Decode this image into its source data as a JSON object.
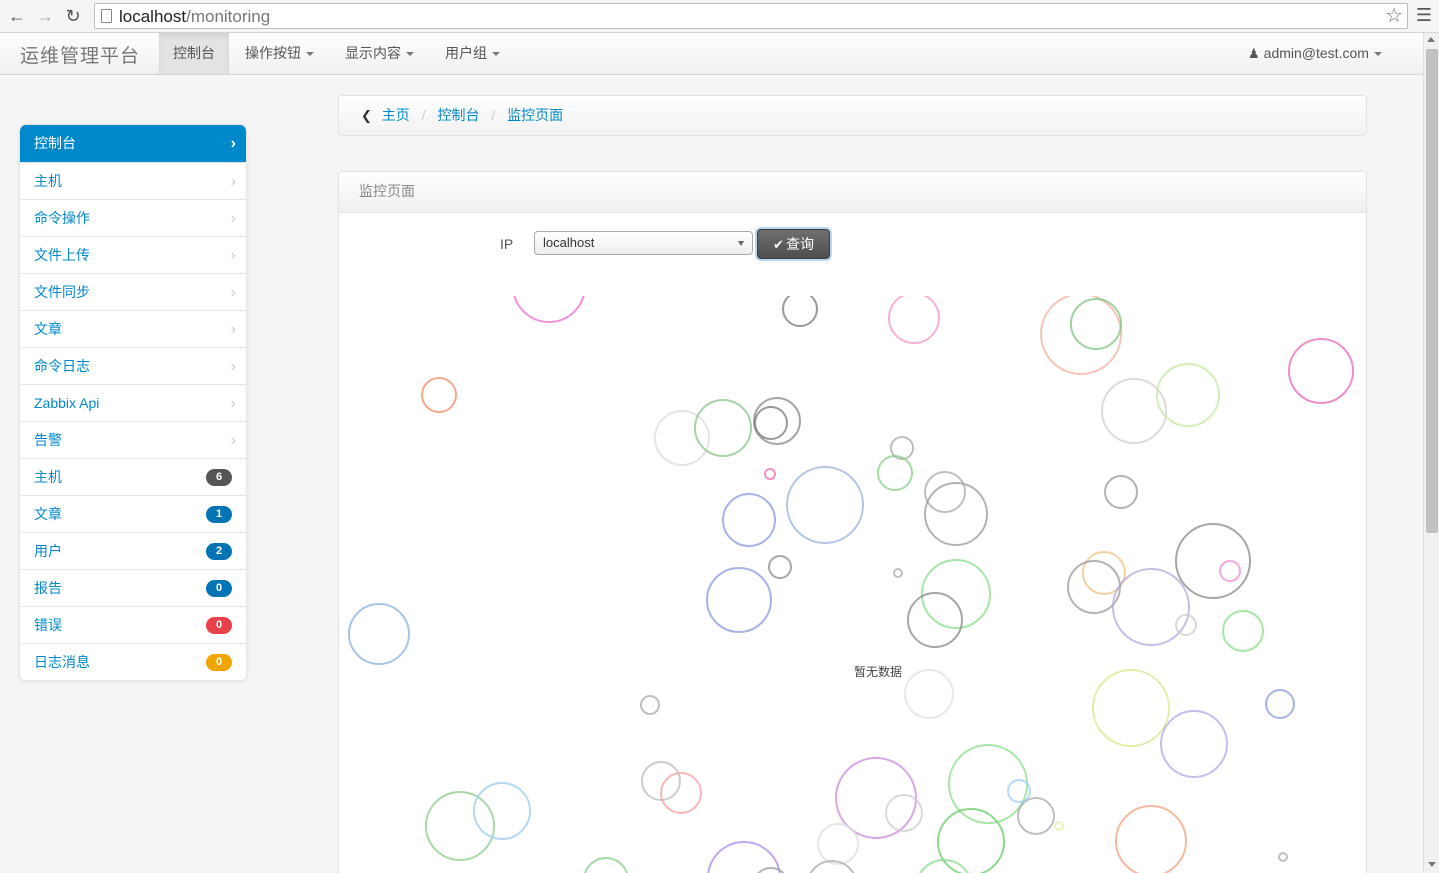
{
  "browser": {
    "url_host": "localhost",
    "url_path": "/monitoring"
  },
  "navbar": {
    "brand": "运维管理平台",
    "items": [
      {
        "label": "控制台",
        "active": true,
        "dropdown": false
      },
      {
        "label": "操作按钮",
        "active": false,
        "dropdown": true
      },
      {
        "label": "显示内容",
        "active": false,
        "dropdown": true
      },
      {
        "label": "用户组",
        "active": false,
        "dropdown": true
      }
    ],
    "user": "admin@test.com"
  },
  "sidebar": {
    "items": [
      {
        "label": "控制台",
        "active": true,
        "type": "chevron"
      },
      {
        "label": "主机",
        "type": "chevron"
      },
      {
        "label": "命令操作",
        "type": "chevron"
      },
      {
        "label": "文件上传",
        "type": "chevron"
      },
      {
        "label": "文件同步",
        "type": "chevron"
      },
      {
        "label": "文章",
        "type": "chevron"
      },
      {
        "label": "命令日志",
        "type": "chevron"
      },
      {
        "label": "Zabbix Api",
        "type": "chevron"
      },
      {
        "label": "告警",
        "type": "chevron"
      },
      {
        "label": "主机",
        "type": "badge",
        "badge": "6",
        "badge_color": "#555555"
      },
      {
        "label": "文章",
        "type": "badge",
        "badge": "1",
        "badge_color": "#0074b4"
      },
      {
        "label": "用户",
        "type": "badge",
        "badge": "2",
        "badge_color": "#0074b4"
      },
      {
        "label": "报告",
        "type": "badge",
        "badge": "0",
        "badge_color": "#0074b4"
      },
      {
        "label": "错误",
        "type": "badge",
        "badge": "0",
        "badge_color": "#e9414a"
      },
      {
        "label": "日志消息",
        "type": "badge",
        "badge": "0",
        "badge_color": "#f0a500"
      }
    ]
  },
  "breadcrumb": {
    "items": [
      "主页",
      "控制台",
      "监控页面"
    ],
    "separator": "/"
  },
  "panel": {
    "title": "监控页面",
    "ip_label": "IP",
    "ip_selected": "localhost",
    "query_label": "查询",
    "empty_text": "暂无数据"
  },
  "colors": {
    "accent": "#0088cc",
    "badge_dark": "#555555",
    "badge_blue": "#0074b4",
    "badge_red": "#e9414a",
    "badge_orange": "#f0a500"
  }
}
